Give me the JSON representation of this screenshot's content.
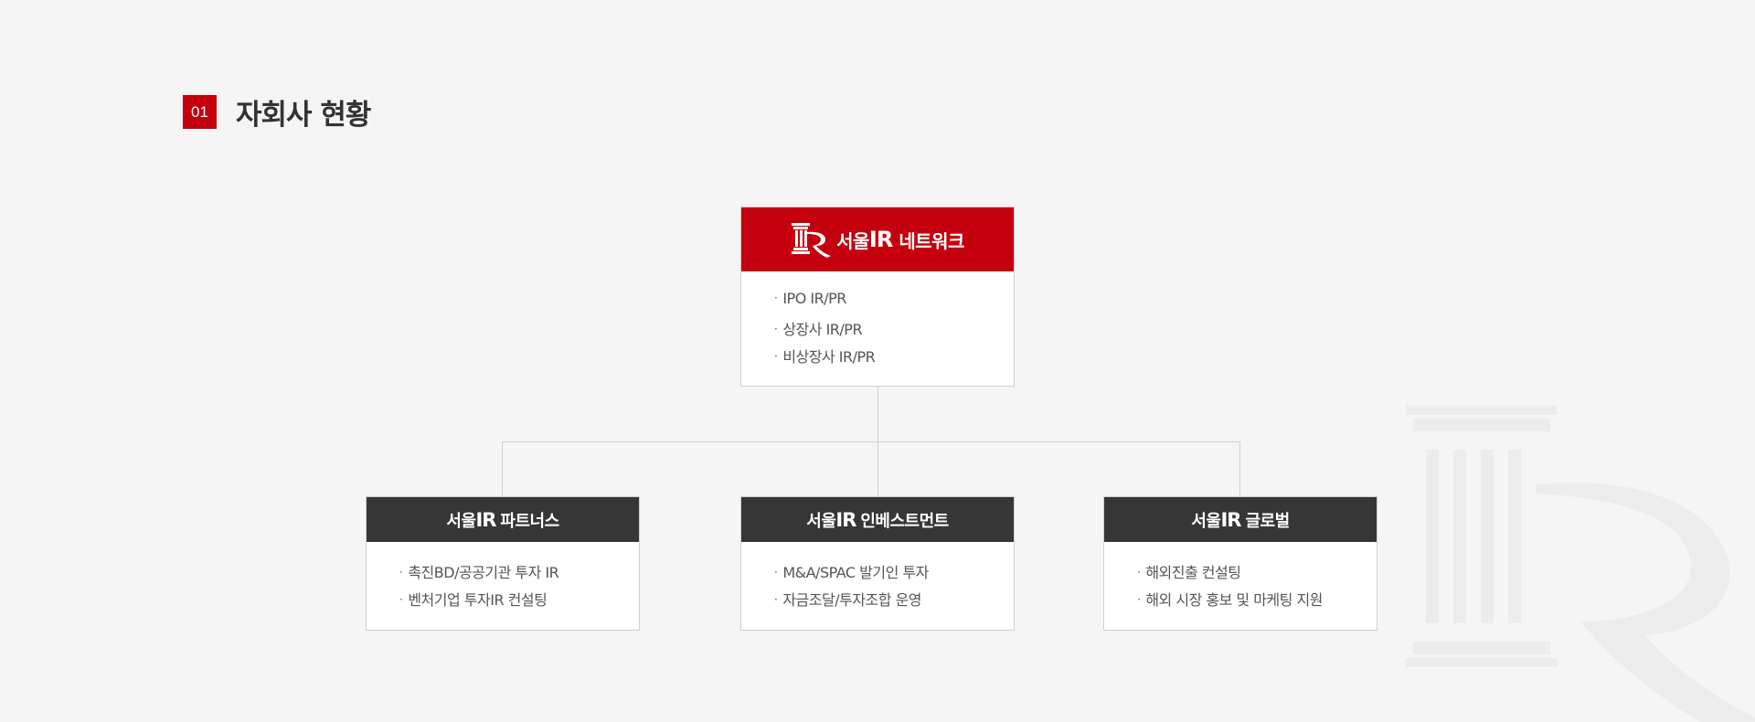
{
  "section": {
    "number": "01",
    "title": "자회사 현황"
  },
  "root": {
    "brand": "서울",
    "brand_ir": "IR",
    "name": "네트워크",
    "items": [
      "IPO IR/PR",
      "상장사 IR/PR",
      "비상장사 IR/PR"
    ]
  },
  "children": [
    {
      "brand": "서울",
      "brand_ir": "IR",
      "name": "파트너스",
      "items": [
        "촉진BD/공공기관 투자 IR",
        "벤처기업 투자IR 컨설팅"
      ]
    },
    {
      "brand": "서울",
      "brand_ir": "IR",
      "name": "인베스트먼트",
      "items": [
        "M&A/SPAC 발기인 투자",
        "자금조달/투자조합 운영"
      ]
    },
    {
      "brand": "서울",
      "brand_ir": "IR",
      "name": "글로벌",
      "items": [
        "해외진출 컨설팅",
        "해외 시장 홍보 및 마케팅 지원"
      ]
    }
  ],
  "bullet": "·",
  "icons": {
    "logo": "seoul-ir-column-logo-icon",
    "watermark": "column-logo-watermark-icon"
  },
  "colors": {
    "accent": "#c4000e",
    "dark": "#363636",
    "background": "#f5f5f5",
    "border": "#d0d0d0"
  }
}
